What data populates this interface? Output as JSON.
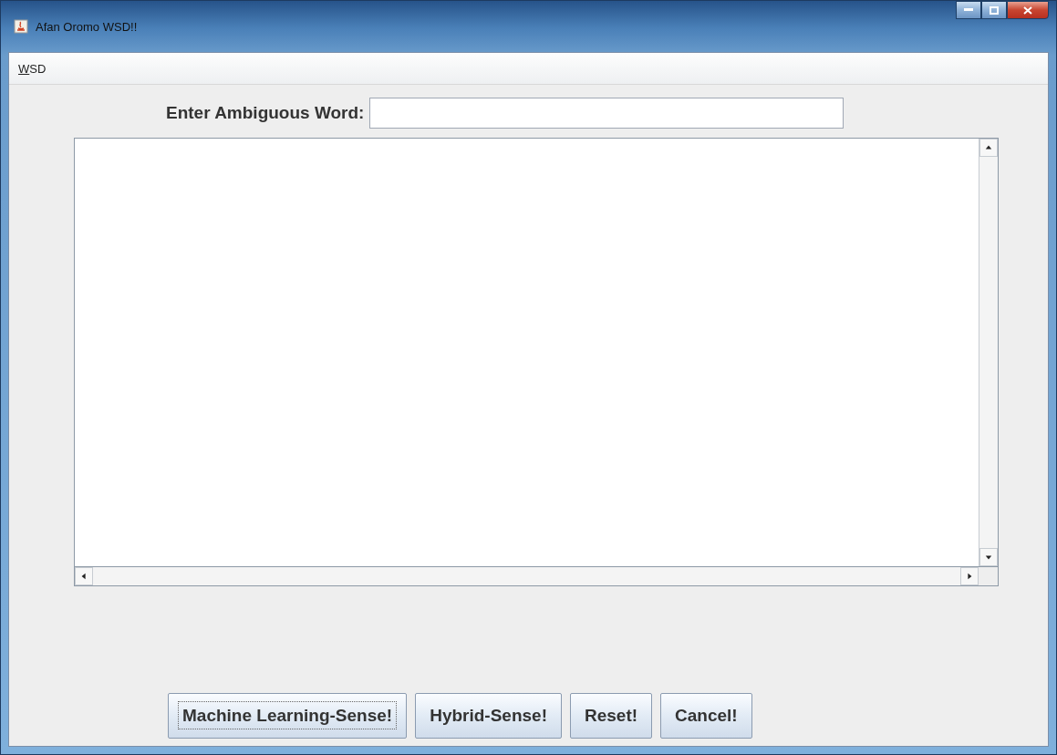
{
  "window": {
    "title": "Afan Oromo WSD!!"
  },
  "menu": [
    {
      "label": "WSD",
      "underline_first": true
    }
  ],
  "word_field": {
    "label": "Enter Ambiguous Word:"
  },
  "buttons": [
    {
      "label": "Machine Learning-Sense!",
      "focused": true
    },
    {
      "label": "Hybrid-Sense!",
      "focused": false
    },
    {
      "label": "Reset!",
      "focused": false
    },
    {
      "label": "Cancel!",
      "focused": false
    }
  ]
}
